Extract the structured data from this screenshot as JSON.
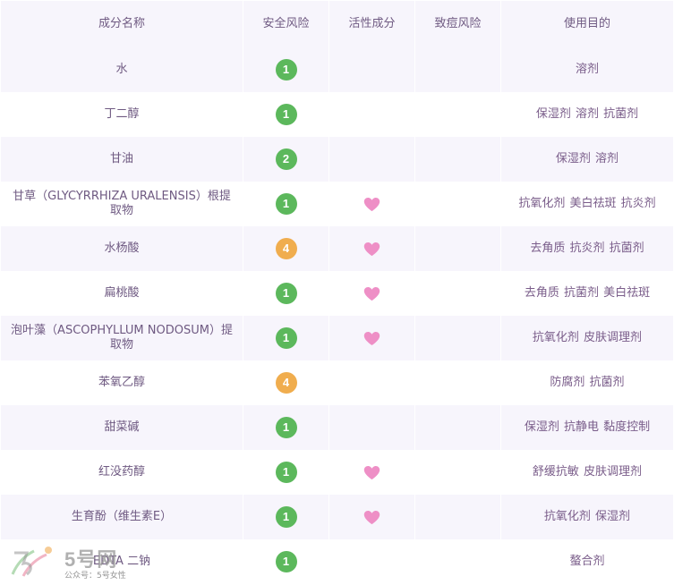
{
  "header": {
    "name": "成分名称",
    "safety": "安全风险",
    "active": "活性成分",
    "acne": "致痘风险",
    "purpose": "使用目的"
  },
  "colors": {
    "risk_low": "#5cb85c",
    "risk_mid": "#f0ad4e",
    "heart": "#ee8fc6",
    "row_alt": "#f7f5fc",
    "text": "#7a5d8a"
  },
  "rows": [
    {
      "name": "水",
      "risk": "1",
      "risk_level": "low",
      "active": false,
      "acne": "",
      "purpose": "溶剂"
    },
    {
      "name": "丁二醇",
      "risk": "1",
      "risk_level": "low",
      "active": false,
      "acne": "",
      "purpose": "保湿剂 溶剂 抗菌剂"
    },
    {
      "name": "甘油",
      "risk": "2",
      "risk_level": "low",
      "active": false,
      "acne": "",
      "purpose": "保湿剂 溶剂"
    },
    {
      "name": "甘草（GLYCYRRHIZA URALENSIS）根提取物",
      "risk": "1",
      "risk_level": "low",
      "active": true,
      "acne": "",
      "purpose": "抗氧化剂 美白祛斑 抗炎剂"
    },
    {
      "name": "水杨酸",
      "risk": "4",
      "risk_level": "mid",
      "active": true,
      "acne": "",
      "purpose": "去角质 抗炎剂 抗菌剂"
    },
    {
      "name": "扁桃酸",
      "risk": "1",
      "risk_level": "low",
      "active": true,
      "acne": "",
      "purpose": "去角质 抗菌剂 美白祛斑"
    },
    {
      "name": "泡叶藻（ASCOPHYLLUM NODOSUM）提取物",
      "risk": "1",
      "risk_level": "low",
      "active": true,
      "acne": "",
      "purpose": "抗氧化剂 皮肤调理剂"
    },
    {
      "name": "苯氧乙醇",
      "risk": "4",
      "risk_level": "mid",
      "active": false,
      "acne": "",
      "purpose": "防腐剂 抗菌剂"
    },
    {
      "name": "甜菜碱",
      "risk": "1",
      "risk_level": "low",
      "active": false,
      "acne": "",
      "purpose": "保湿剂 抗静电 黏度控制"
    },
    {
      "name": "红没药醇",
      "risk": "1",
      "risk_level": "low",
      "active": true,
      "acne": "",
      "purpose": "舒缓抗敏 皮肤调理剂"
    },
    {
      "name": "生育酚（维生素E）",
      "risk": "1",
      "risk_level": "low",
      "active": true,
      "acne": "",
      "purpose": "抗氧化剂 保湿剂"
    },
    {
      "name": "EDTA 二钠",
      "risk": "1",
      "risk_level": "low",
      "active": false,
      "acne": "",
      "purpose": "螯合剂"
    }
  ],
  "watermark": {
    "brand": "5号网",
    "sub": "公众号：5号女性"
  }
}
